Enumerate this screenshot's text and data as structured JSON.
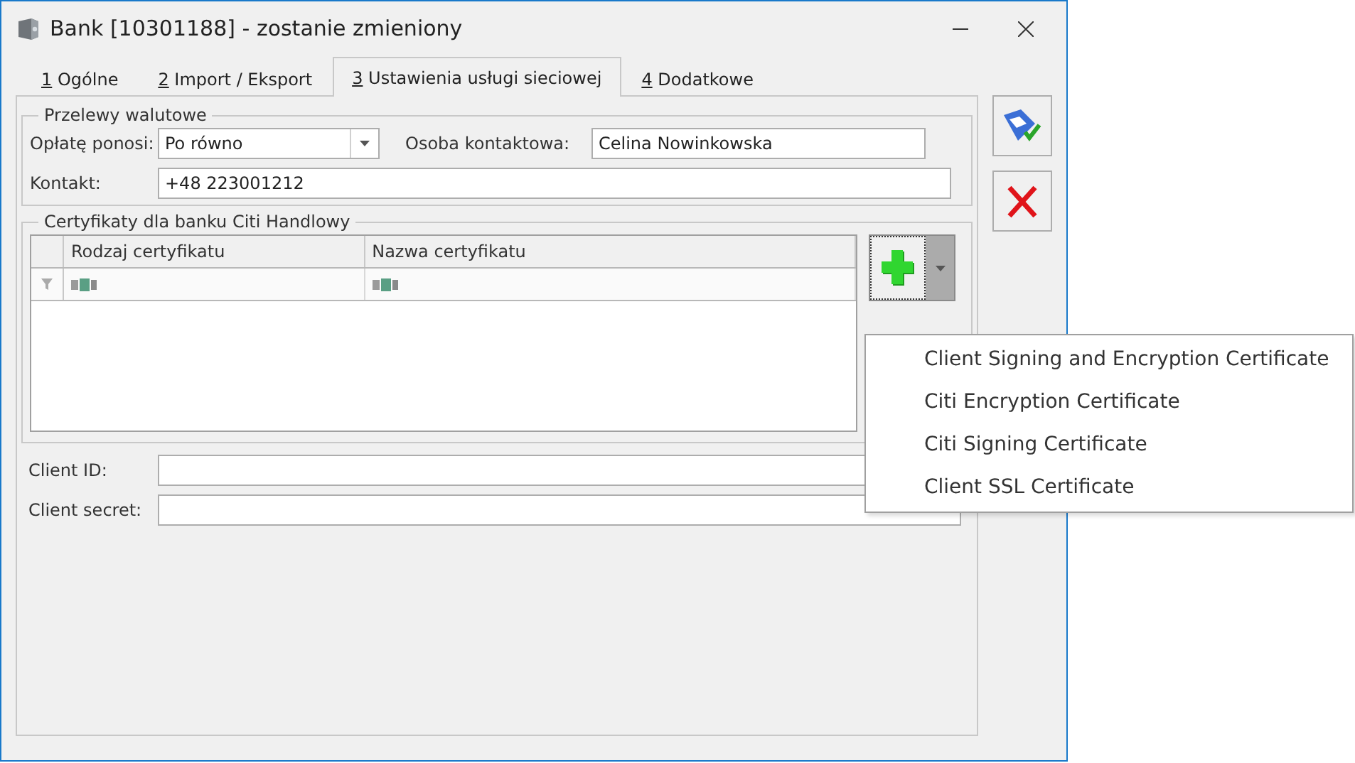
{
  "window": {
    "title": "Bank [10301188] - zostanie zmieniony"
  },
  "tabs": [
    {
      "key": "1",
      "label": "Ogólne",
      "selected": false
    },
    {
      "key": "2",
      "label": "Import / Eksport",
      "selected": false
    },
    {
      "key": "3",
      "label": "Ustawienia usługi sieciowej",
      "selected": true
    },
    {
      "key": "4",
      "label": "Dodatkowe",
      "selected": false
    }
  ],
  "transfers": {
    "title": "Przelewy walutowe",
    "fee_label": "Opłatę ponosi:",
    "fee_value": "Po równo",
    "person_label": "Osoba kontaktowa:",
    "person_value": "Celina Nowinkowska",
    "contact_label": "Kontakt:",
    "contact_value": "+48 223001212"
  },
  "certificates": {
    "title": "Certyfikaty dla banku Citi Handlowy",
    "columns": [
      "Rodzaj certyfikatu",
      "Nazwa certyfikatu"
    ]
  },
  "add_menu": {
    "items": [
      "Client Signing and Encryption Certificate",
      "Citi Encryption Certificate",
      "Citi Signing Certificate",
      "Client SSL Certificate"
    ]
  },
  "client_id_label": "Client ID:",
  "client_secret_label": "Client secret:"
}
